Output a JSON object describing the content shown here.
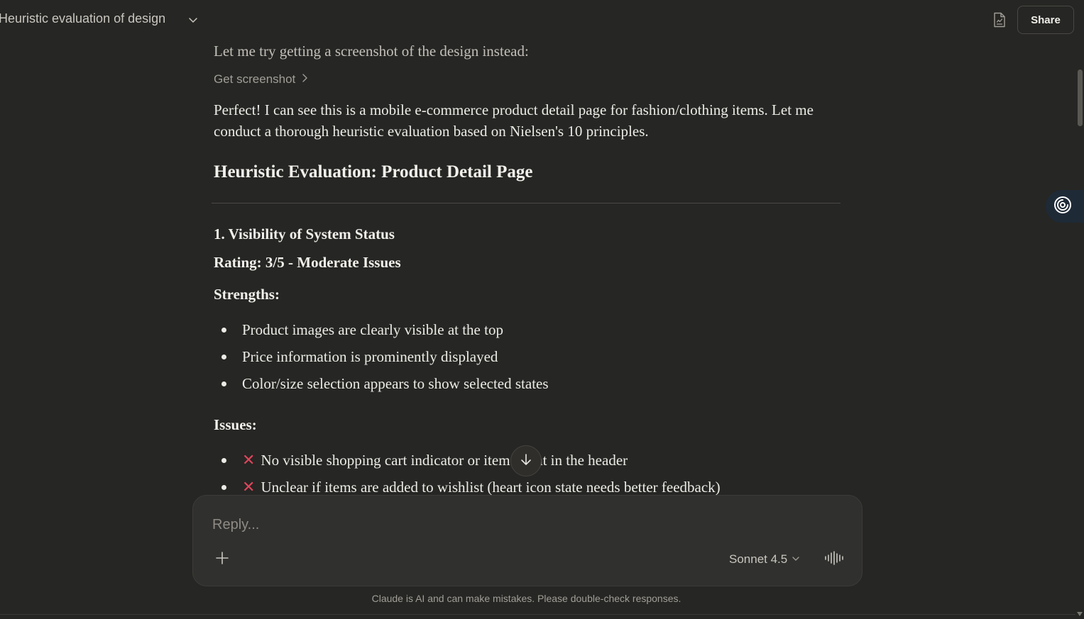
{
  "header": {
    "title": "Heuristic evaluation of design",
    "share_label": "Share"
  },
  "content": {
    "faded_line": "Let me try getting a screenshot of the design instead:",
    "tool_label": "Get screenshot",
    "intro_paragraph": "Perfect! I can see this is a mobile e-commerce product detail page for fashion/clothing items. Let me conduct a thorough heuristic evaluation based on Nielsen's 10 principles.",
    "heading": "Heuristic Evaluation: Product Detail Page",
    "section_title": "1. Visibility of System Status",
    "rating": "Rating: 3/5 - Moderate Issues",
    "strengths_label": "Strengths:",
    "strengths": [
      "Product images are clearly visible at the top",
      "Price information is prominently displayed",
      "Color/size selection appears to show selected states"
    ],
    "issues_label": "Issues:",
    "issues": [
      "No visible shopping cart indicator or item count in the header",
      "Unclear if items are added to wishlist (heart icon state needs better feedback)"
    ]
  },
  "composer": {
    "placeholder": "Reply...",
    "model": "Sonnet 4.5"
  },
  "footer": {
    "disclaimer": "Claude is AI and can make mistakes. Please double-check responses."
  },
  "colors": {
    "background": "#262624",
    "composer_bg": "#30302e",
    "error_mark": "#e0455b",
    "floating_tab_bg": "#1f2a37"
  },
  "icons": [
    "chevron-down-icon",
    "document-icon",
    "chevron-right-icon",
    "arrow-down-icon",
    "plus-icon",
    "voice-waveform-icon",
    "assistant-swirl-icon",
    "close-x-icon"
  ]
}
